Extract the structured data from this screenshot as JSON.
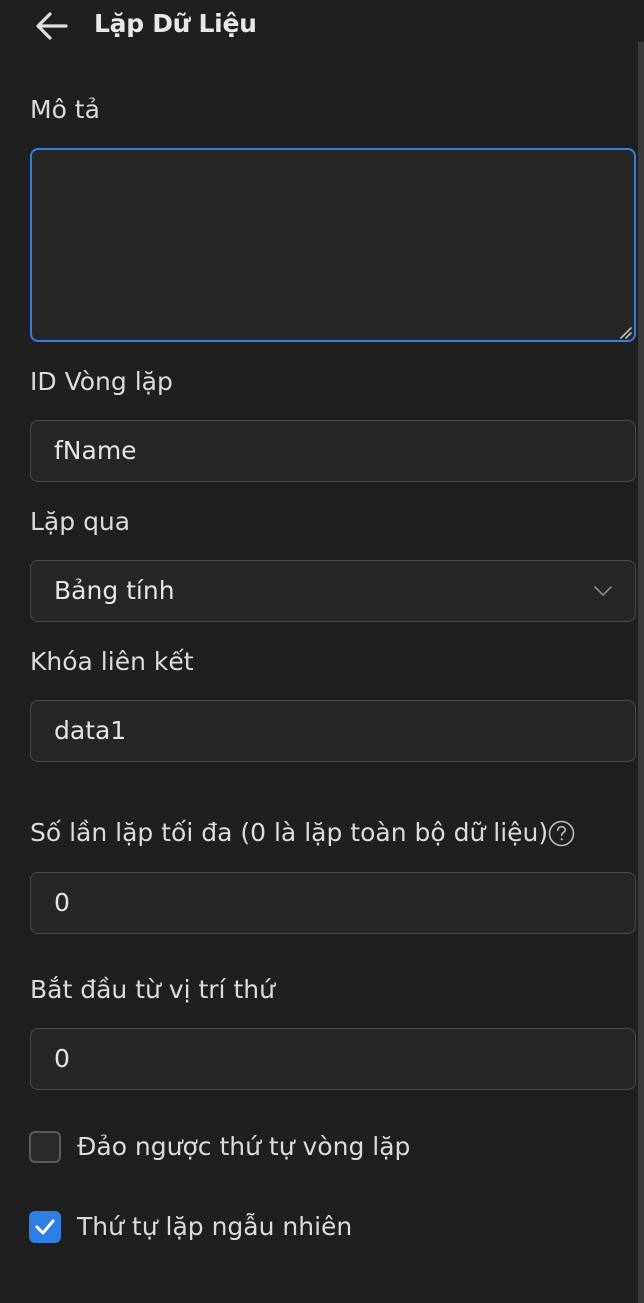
{
  "header": {
    "title": "Lặp Dữ Liệu",
    "back_icon": "arrow-left-icon"
  },
  "form": {
    "description": {
      "label": "Mô tả",
      "value": ""
    },
    "loop_id": {
      "label": "ID Vòng lặp",
      "value": "fName"
    },
    "loop_over": {
      "label": "Lặp qua",
      "selected": "Bảng tính",
      "icon": "chevron-down-icon"
    },
    "link_key": {
      "label": "Khóa liên kết",
      "value": "data1"
    },
    "max_iterations": {
      "label": "Số lần lặp tối đa (0 là lặp toàn bộ dữ liệu)",
      "value": "0",
      "icon": "help-circle-icon"
    },
    "start_index": {
      "label": "Bắt đầu từ vị trí thứ",
      "value": "0"
    },
    "reverse_order": {
      "label": "Đảo ngược thứ tự vòng lặp",
      "checked": false
    },
    "random_order": {
      "label": "Thứ tự lặp ngẫu nhiên",
      "checked": true
    }
  },
  "colors": {
    "background": "#1f1f1f",
    "field_background": "#262626",
    "focus_border": "#3a7be0",
    "checkbox_checked": "#2f7ee6"
  }
}
